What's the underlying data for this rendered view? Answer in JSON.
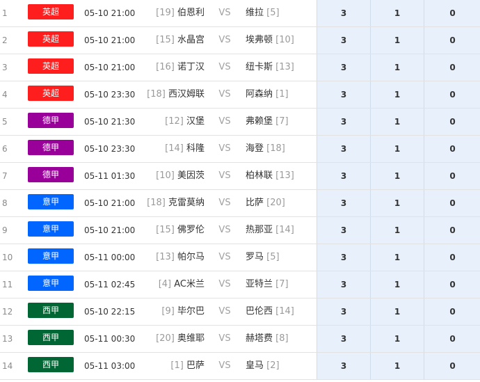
{
  "league_colors": {
    "英超": "#ff1e1e",
    "德甲": "#990099",
    "意甲": "#0066ff",
    "西甲": "#006633"
  },
  "matches": [
    {
      "num": "1",
      "league": "英超",
      "time": "05-10 21:00",
      "home_rank": "[19]",
      "home_team": "伯恩利",
      "vs": "VS",
      "away_team": "维拉",
      "away_rank": "[5]",
      "odds": [
        "3",
        "1",
        "0"
      ]
    },
    {
      "num": "2",
      "league": "英超",
      "time": "05-10 21:00",
      "home_rank": "[15]",
      "home_team": "水晶宫",
      "vs": "VS",
      "away_team": "埃弗顿",
      "away_rank": "[10]",
      "odds": [
        "3",
        "1",
        "0"
      ]
    },
    {
      "num": "3",
      "league": "英超",
      "time": "05-10 21:00",
      "home_rank": "[16]",
      "home_team": "诺丁汉",
      "vs": "VS",
      "away_team": "纽卡斯",
      "away_rank": "[13]",
      "odds": [
        "3",
        "1",
        "0"
      ]
    },
    {
      "num": "4",
      "league": "英超",
      "time": "05-10 23:30",
      "home_rank": "[18]",
      "home_team": "西汉姆联",
      "vs": "VS",
      "away_team": "阿森纳",
      "away_rank": "[1]",
      "odds": [
        "3",
        "1",
        "0"
      ]
    },
    {
      "num": "5",
      "league": "德甲",
      "time": "05-10 21:30",
      "home_rank": "[12]",
      "home_team": "汉堡",
      "vs": "VS",
      "away_team": "弗赖堡",
      "away_rank": "[7]",
      "odds": [
        "3",
        "1",
        "0"
      ]
    },
    {
      "num": "6",
      "league": "德甲",
      "time": "05-10 23:30",
      "home_rank": "[14]",
      "home_team": "科隆",
      "vs": "VS",
      "away_team": "海登",
      "away_rank": "[18]",
      "odds": [
        "3",
        "1",
        "0"
      ]
    },
    {
      "num": "7",
      "league": "德甲",
      "time": "05-11 01:30",
      "home_rank": "[10]",
      "home_team": "美因茨",
      "vs": "VS",
      "away_team": "柏林联",
      "away_rank": "[13]",
      "odds": [
        "3",
        "1",
        "0"
      ]
    },
    {
      "num": "8",
      "league": "意甲",
      "time": "05-10 21:00",
      "home_rank": "[18]",
      "home_team": "克雷莫纳",
      "vs": "VS",
      "away_team": "比萨",
      "away_rank": "[20]",
      "odds": [
        "3",
        "1",
        "0"
      ]
    },
    {
      "num": "9",
      "league": "意甲",
      "time": "05-10 21:00",
      "home_rank": "[15]",
      "home_team": "佛罗伦",
      "vs": "VS",
      "away_team": "热那亚",
      "away_rank": "[14]",
      "odds": [
        "3",
        "1",
        "0"
      ]
    },
    {
      "num": "10",
      "league": "意甲",
      "time": "05-11 00:00",
      "home_rank": "[13]",
      "home_team": "帕尔马",
      "vs": "VS",
      "away_team": "罗马",
      "away_rank": "[5]",
      "odds": [
        "3",
        "1",
        "0"
      ]
    },
    {
      "num": "11",
      "league": "意甲",
      "time": "05-11 02:45",
      "home_rank": "[4]",
      "home_team": "AC米兰",
      "vs": "VS",
      "away_team": "亚特兰",
      "away_rank": "[7]",
      "odds": [
        "3",
        "1",
        "0"
      ]
    },
    {
      "num": "12",
      "league": "西甲",
      "time": "05-10 22:15",
      "home_rank": "[9]",
      "home_team": "毕尔巴",
      "vs": "VS",
      "away_team": "巴伦西",
      "away_rank": "[14]",
      "odds": [
        "3",
        "1",
        "0"
      ]
    },
    {
      "num": "13",
      "league": "西甲",
      "time": "05-11 00:30",
      "home_rank": "[20]",
      "home_team": "奥维耶",
      "vs": "VS",
      "away_team": "赫塔费",
      "away_rank": "[8]",
      "odds": [
        "3",
        "1",
        "0"
      ]
    },
    {
      "num": "14",
      "league": "西甲",
      "time": "05-11 03:00",
      "home_rank": "[1]",
      "home_team": "巴萨",
      "vs": "VS",
      "away_team": "皇马",
      "away_rank": "[2]",
      "odds": [
        "3",
        "1",
        "0"
      ]
    }
  ]
}
